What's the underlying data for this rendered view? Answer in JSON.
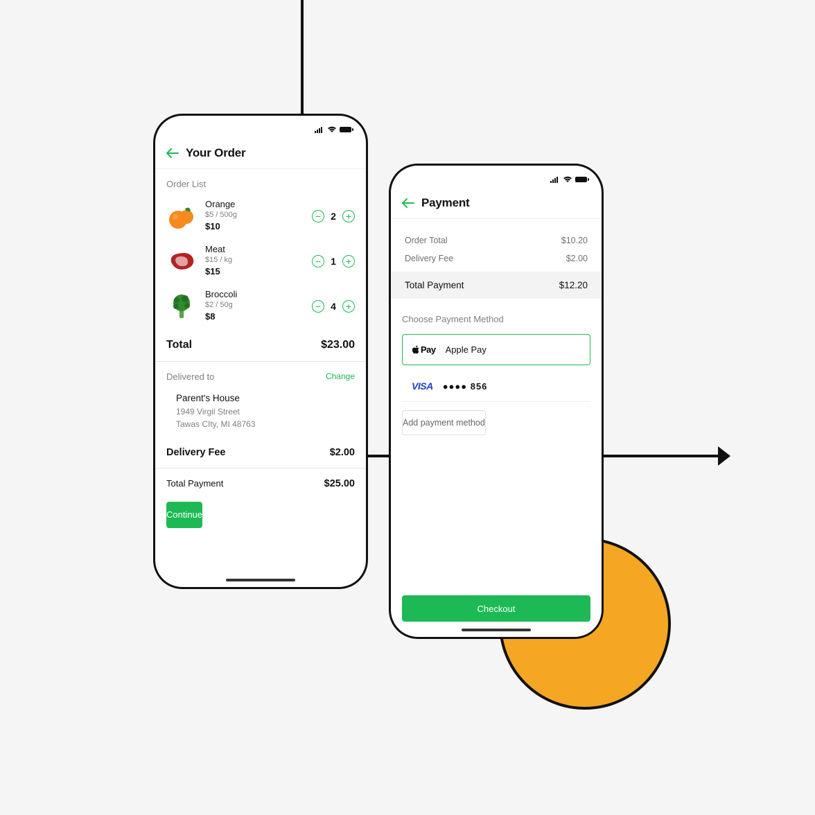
{
  "order_screen": {
    "title": "Your Order",
    "list_label": "Order List",
    "items": [
      {
        "name": "Orange",
        "unit_price": "$5 / 500g",
        "subtotal": "$10",
        "qty": "2"
      },
      {
        "name": "Meat",
        "unit_price": "$15 / kg",
        "subtotal": "$15",
        "qty": "1"
      },
      {
        "name": "Broccoli",
        "unit_price": "$2 / 50g",
        "subtotal": "$8",
        "qty": "4"
      }
    ],
    "total_label": "Total",
    "total_value": "$23.00",
    "delivered_to_label": "Delivered to",
    "change_label": "Change",
    "address": {
      "name": "Parent's House",
      "street": "1949  Virgil Street",
      "city": "Tawas CIty, MI 48763"
    },
    "delivery_fee_label": "Delivery Fee",
    "delivery_fee_value": "$2.00",
    "total_payment_label": "Total Payment",
    "total_payment_value": "$25.00",
    "continue_label": "Continue"
  },
  "payment_screen": {
    "title": "Payment",
    "order_total_label": "Order Total",
    "order_total_value": "$10.20",
    "delivery_fee_label": "Delivery Fee",
    "delivery_fee_value": "$2.00",
    "total_payment_label": "Total Payment",
    "total_payment_value": "$12.20",
    "choose_method_label": "Choose Payment Method",
    "apple_pay_label": "Apple Pay",
    "apple_pay_mark": "Pay",
    "visa_mark": "VISA",
    "card_masked": "●●●● 856",
    "add_method_label": "Add payment method",
    "checkout_label": "Checkout"
  }
}
